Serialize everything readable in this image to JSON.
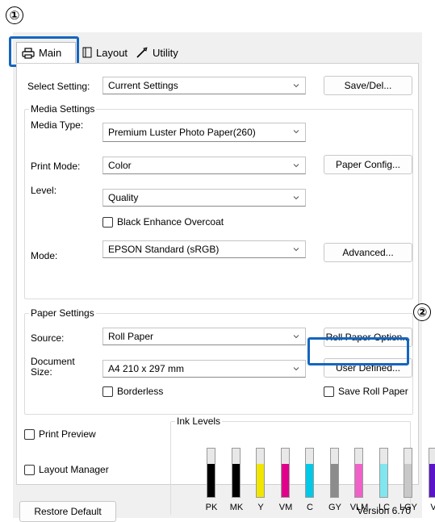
{
  "callouts": {
    "one": "①",
    "two": "②"
  },
  "tabs": [
    {
      "label": "Main",
      "icon": "printer-icon",
      "active": true
    },
    {
      "label": "Layout",
      "icon": "page-layout-icon",
      "active": false
    },
    {
      "label": "Utility",
      "icon": "wrench-icon",
      "active": false
    }
  ],
  "select_setting": {
    "label": "Select Setting:",
    "value": "Current Settings",
    "button": "Save/Del..."
  },
  "media_settings": {
    "title": "Media Settings",
    "media_type": {
      "label": "Media Type:",
      "value": "Premium Luster Photo Paper(260)"
    },
    "print_mode": {
      "label": "Print Mode:",
      "value": "Color",
      "button": "Paper Config..."
    },
    "level": {
      "label": "Level:",
      "value": "Quality"
    },
    "black_enhance": {
      "label": "Black Enhance Overcoat",
      "checked": false
    },
    "mode": {
      "label": "Mode:",
      "value": "EPSON Standard (sRGB)",
      "button": "Advanced..."
    }
  },
  "paper_settings": {
    "title": "Paper Settings",
    "source": {
      "label": "Source:",
      "value": "Roll Paper",
      "button": "Roll Paper Option..."
    },
    "document_size": {
      "label": "Document Size:",
      "value": "A4 210 x 297 mm",
      "button": "User Defined..."
    },
    "borderless": {
      "label": "Borderless",
      "checked": false
    },
    "save_roll_paper": {
      "label": "Save Roll Paper",
      "checked": false
    }
  },
  "print_preview": {
    "label": "Print Preview",
    "checked": false
  },
  "layout_manager": {
    "label": "Layout Manager",
    "checked": false
  },
  "ink_levels": {
    "title": "Ink Levels",
    "inks": [
      {
        "code": "PK",
        "color": "#000000",
        "level": 0.68
      },
      {
        "code": "MK",
        "color": "#000000",
        "level": 0.68
      },
      {
        "code": "Y",
        "color": "#f0e600",
        "level": 0.68
      },
      {
        "code": "VM",
        "color": "#e0008c",
        "level": 0.68
      },
      {
        "code": "C",
        "color": "#00c8e6",
        "level": 0.68
      },
      {
        "code": "GY",
        "color": "#8c8c8c",
        "level": 0.68
      },
      {
        "code": "VLM",
        "color": "#f060c8",
        "level": 0.68
      },
      {
        "code": "LC",
        "color": "#80e6f0",
        "level": 0.68
      },
      {
        "code": "LGY",
        "color": "#c8c8c8",
        "level": 0.68
      },
      {
        "code": "V",
        "color": "#5a14c8",
        "level": 0.68
      }
    ]
  },
  "footer": {
    "restore_default": "Restore Default",
    "version": "Version 6.70"
  },
  "colors": {
    "highlight": "#1565c0",
    "panel_bg": "#ffffff",
    "dialog_bg": "#f0f0f0"
  }
}
